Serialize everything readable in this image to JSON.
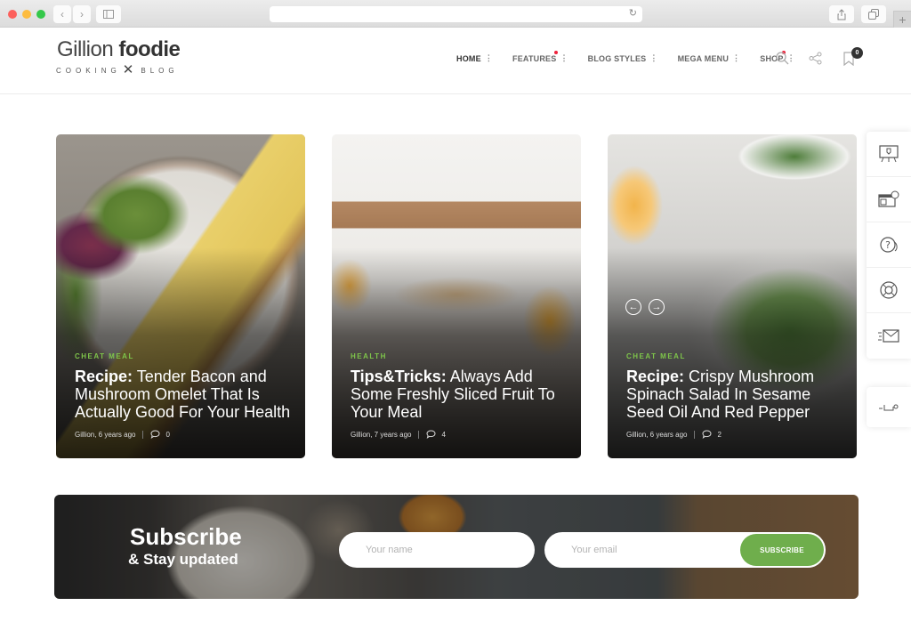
{
  "browser": {
    "url": "",
    "buttons": {
      "back": "‹",
      "forward": "›",
      "reload": "↻",
      "new_tab": "+"
    }
  },
  "header": {
    "logo": {
      "light": "Gillion",
      "bold": "foodie",
      "tagline_left": "COOKING",
      "tagline_right": "BLOG"
    },
    "nav": [
      {
        "label": "HOME",
        "active": true,
        "dot": false
      },
      {
        "label": "FEATURES",
        "active": false,
        "dot": true
      },
      {
        "label": "BLOG STYLES",
        "active": false,
        "dot": false
      },
      {
        "label": "MEGA MENU",
        "active": false,
        "dot": false
      },
      {
        "label": "SHOP",
        "active": false,
        "dot": true
      }
    ],
    "cart_count": "0"
  },
  "cards": [
    {
      "category": "CHEAT MEAL",
      "title_bold": "Recipe:",
      "title_rest": " Tender Bacon and Mushroom Omelet That Is Actually Good For Your Health",
      "author_time": "Gillion, 6 years ago",
      "comments": "0"
    },
    {
      "category": "HEALTH",
      "title_bold": "Tips&Tricks:",
      "title_rest": " Always Add Some Freshly Sliced Fruit To Your Meal",
      "author_time": "Gillion, 7 years ago",
      "comments": "4"
    },
    {
      "category": "CHEAT MEAL",
      "title_bold": "Recipe:",
      "title_rest": " Crispy Mushroom Spinach Salad In Sesame Seed Oil And Red Pepper",
      "author_time": "Gillion, 6 years ago",
      "comments": "2"
    }
  ],
  "slider": {
    "prev": "←",
    "next": "→"
  },
  "side_tools": [
    "presentation-icon",
    "shop-icon",
    "help-icon",
    "support-icon",
    "mail-icon"
  ],
  "subscribe": {
    "title": "Subscribe",
    "subtitle": "& Stay updated",
    "name_placeholder": "Your name",
    "email_placeholder": "Your email",
    "button": "SUBSCRIBE"
  },
  "colors": {
    "accent": "#6fae4c",
    "category": "#7ec54a",
    "nav_dot": "#ef233c"
  }
}
